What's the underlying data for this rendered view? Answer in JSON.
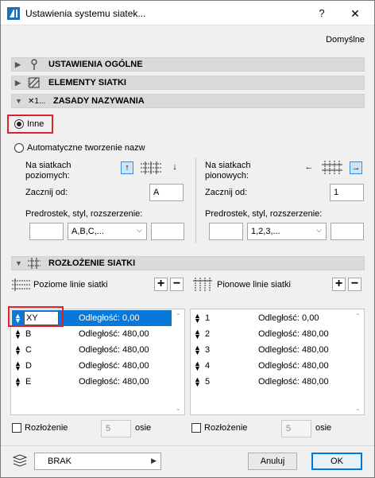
{
  "window": {
    "title": "Ustawienia systemu siatek...",
    "help_label": "?",
    "close_label": "✕"
  },
  "defaults_label": "Domyślne",
  "sections": [
    {
      "title": "USTAWIENIA OGÓLNE",
      "expanded": false,
      "icon": "pin-icon"
    },
    {
      "title": "ELEMENTY SIATKI",
      "expanded": false,
      "icon": "grid-element-icon"
    },
    {
      "title": "ZASADY NAZYWANIA",
      "expanded": true,
      "icon": "naming-icon",
      "icon_text": "✕1..."
    },
    {
      "title": "ROZŁOŻENIE SIATKI",
      "expanded": true,
      "icon": "grid-layout-icon"
    }
  ],
  "naming": {
    "option_other": "Inne",
    "option_auto": "Automatyczne tworzenie nazw",
    "selected": "Inne",
    "horizontal": {
      "label": "Na siatkach poziomych:",
      "start_label": "Zacznij od:",
      "start_value": "A",
      "prefix_label": "Predrostek, styl, rozszerzenie:",
      "prefix_value": "",
      "style_value": "A,B,C,...",
      "suffix_value": "",
      "direction_selected": "up"
    },
    "vertical": {
      "label": "Na siatkach pionowych:",
      "start_label": "Zacznij od:",
      "start_value": "1",
      "prefix_label": "Predrostek, styl, rozszerzenie:",
      "prefix_value": "",
      "style_value": "1,2,3,...",
      "suffix_value": "",
      "direction_selected": "right"
    }
  },
  "layout": {
    "horizontal": {
      "title": "Poziome linie siatki",
      "add_label": "+",
      "remove_label": "−",
      "rows": [
        {
          "name": "XY",
          "distance": "Odległość: 0,00",
          "selected": true,
          "editing": true
        },
        {
          "name": "B",
          "distance": "Odległość: 480,00"
        },
        {
          "name": "C",
          "distance": "Odległość: 480,00"
        },
        {
          "name": "D",
          "distance": "Odległość: 480,00"
        },
        {
          "name": "E",
          "distance": "Odległość: 480,00"
        }
      ],
      "distribution_label": "Rozłożenie",
      "distribution_count": "5",
      "axes_label": "osie"
    },
    "vertical": {
      "title": "Pionowe linie siatki",
      "add_label": "+",
      "remove_label": "−",
      "rows": [
        {
          "name": "1",
          "distance": "Odległość: 0,00"
        },
        {
          "name": "2",
          "distance": "Odległość: 480,00"
        },
        {
          "name": "3",
          "distance": "Odległość: 480,00"
        },
        {
          "name": "4",
          "distance": "Odległość: 480,00"
        },
        {
          "name": "5",
          "distance": "Odległość: 480,00"
        }
      ],
      "distribution_label": "Rozłożenie",
      "distribution_count": "5",
      "axes_label": "osie"
    }
  },
  "footer": {
    "layer_value": "BRAK",
    "cancel_label": "Anuluj",
    "ok_label": "OK"
  },
  "colors": {
    "selection": "#0a78d7",
    "highlight": "#e0202a",
    "active_toggle": "#cce4f7"
  }
}
